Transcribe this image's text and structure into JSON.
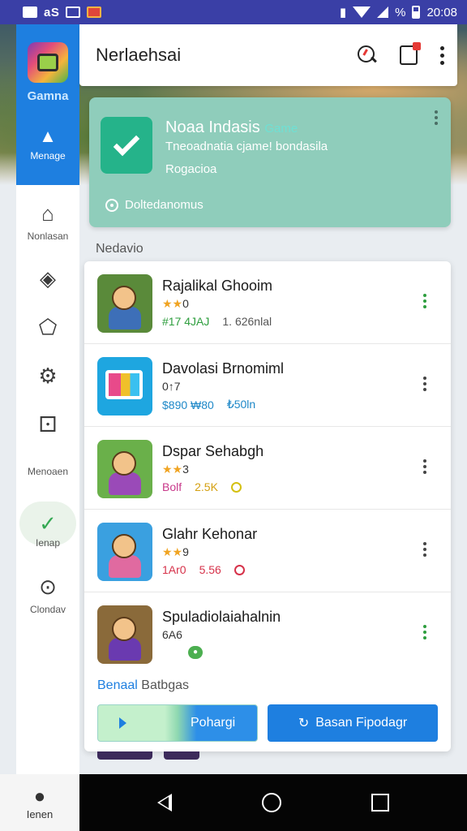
{
  "status_bar": {
    "carrier": "aS",
    "battery_pct": "%",
    "time": "20:08"
  },
  "colors": {
    "primary": "#1e7fe0",
    "promo_bg": "#8fcdbb",
    "status_bar": "#3a3fa6",
    "accent_green": "#34a853"
  },
  "rail": {
    "brand": "Gamna",
    "active": {
      "label": "Menage",
      "icon": "paw-icon"
    },
    "items": [
      {
        "label": "Nonlasan",
        "icon": "home-icon"
      },
      {
        "label": "",
        "icon": "layers-icon"
      },
      {
        "label": "",
        "icon": "puzzle-icon"
      },
      {
        "label": "",
        "icon": "settings-icon"
      },
      {
        "label": "Menoaen",
        "icon": "dice-icon"
      },
      {
        "label": "Ienap",
        "icon": "leaf-icon"
      },
      {
        "label": "Clondav",
        "icon": "search-circle-icon"
      }
    ],
    "bottom": {
      "label": "Ienen",
      "icon": "person-icon"
    }
  },
  "appbar": {
    "title": "Nerlaehsai"
  },
  "promo": {
    "title": "Noaa Indasis",
    "title_accent": "Game",
    "subtitle": "Tneoadnatia cjame! bondasila",
    "tag": "Rogacioa",
    "link": "Doltedanomus"
  },
  "section_label": "Nedavio",
  "games": [
    {
      "name": "Rajalikal Ghooim",
      "stars": "★★",
      "rating": "0",
      "meta1": "#17 4JAJ",
      "meta1_color": "#2e9e3e",
      "meta2": "1. 626nlal",
      "meta2_color": "#555555",
      "dots_color": "#2e9e3e",
      "thumb_bg": "#5a8a3a",
      "body_color": "#3d6fb8"
    },
    {
      "name": "Davolasi Brnomiml",
      "stars": "",
      "rating": "0↑7",
      "meta1": "$890 ₩80",
      "meta1_color": "#1e88c8",
      "meta2": "₺50ln",
      "meta2_color": "#1e88c8",
      "dots_color": "#444444",
      "thumb_bg": "#1ea6e0",
      "body_color": "#e8c42a"
    },
    {
      "name": "Dspar Sehabgh",
      "stars": "★★",
      "rating": "3",
      "meta1": "Bolf",
      "meta1_color": "#c8388a",
      "meta2": "2.5K",
      "meta2_color": "#d4a011",
      "dots_color": "#444444",
      "thumb_bg": "#6ab04a",
      "body_color": "#9a4ab8"
    },
    {
      "name": "Glahr Kehonar",
      "stars": "★★",
      "rating": "9",
      "meta1": "1Ar0",
      "meta1_color": "#d6324a",
      "meta2": "5.56",
      "meta2_color": "#d6324a",
      "dots_color": "#444444",
      "thumb_bg": "#3aa0e0",
      "body_color": "#e06aa0"
    },
    {
      "name": "Spuladiolaiahalnin",
      "stars": "",
      "rating": "6A6",
      "meta1": "",
      "meta1_color": "#444444",
      "meta2": "",
      "meta2_color": "#444444",
      "dots_color": "#2e9e3e",
      "thumb_bg": "#8a6a3a",
      "body_color": "#6a3ab0"
    }
  ],
  "footer": {
    "highlight": "Benaal",
    "rest": "Batbgas"
  },
  "buttons": {
    "left": "Pohargi",
    "right": "Basan Fipodagr"
  }
}
